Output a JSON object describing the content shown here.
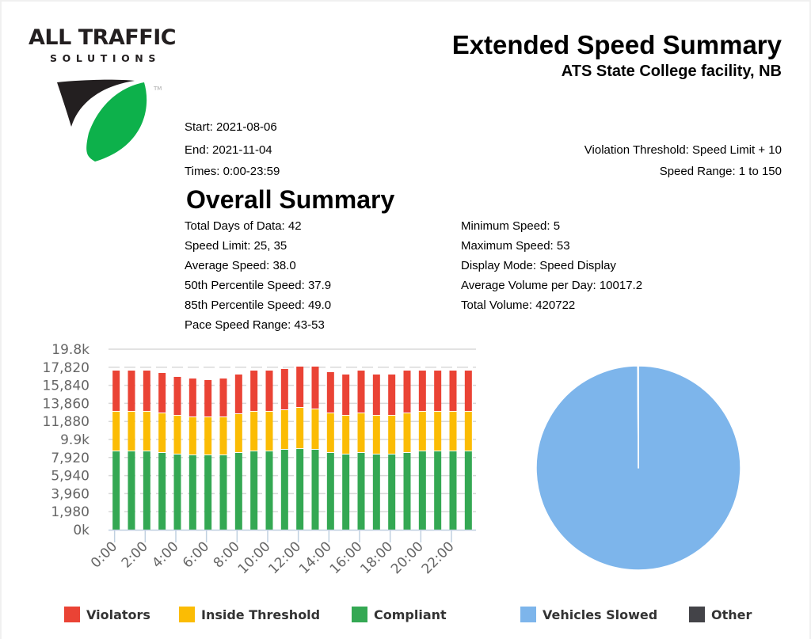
{
  "brand": {
    "name": "ALL TRAFFIC",
    "sub": "SOLUTIONS",
    "tm": "TM",
    "colors": {
      "dark": "#231f20",
      "green": "#0db14b"
    }
  },
  "header": {
    "title": "Extended Speed Summary",
    "subtitle": "ATS State College facility, NB"
  },
  "meta": {
    "start": "Start: 2021-08-06",
    "end": "End: 2021-11-04",
    "times": "Times: 0:00-23:59",
    "violation_threshold": "Violation Threshold: Speed Limit + 10",
    "speed_range": "Speed Range: 1 to 150"
  },
  "summary": {
    "heading": "Overall Summary",
    "left": [
      "Total Days of Data: 42",
      "Speed Limit: 25, 35",
      "Average Speed: 38.0",
      "50th Percentile Speed: 37.9",
      "85th Percentile Speed: 49.0",
      "Pace Speed Range: 43-53"
    ],
    "right": [
      "Minimum Speed: 5",
      "Maximum Speed: 53",
      "Display Mode: Speed Display",
      "Average Volume per Day: 10017.2",
      "Total Volume: 420722"
    ]
  },
  "chart_data": [
    {
      "type": "bar",
      "stacked": true,
      "title": "",
      "xlabel": "",
      "ylabel": "",
      "categories": [
        "0:00",
        "1:00",
        "2:00",
        "3:00",
        "4:00",
        "5:00",
        "6:00",
        "7:00",
        "8:00",
        "9:00",
        "10:00",
        "11:00",
        "12:00",
        "13:00",
        "14:00",
        "15:00",
        "16:00",
        "17:00",
        "18:00",
        "19:00",
        "20:00",
        "21:00",
        "22:00",
        "23:00"
      ],
      "x_tick_labels": [
        "0:00",
        "2:00",
        "4:00",
        "6:00",
        "8:00",
        "10:00",
        "12:00",
        "14:00",
        "16:00",
        "18:00",
        "20:00",
        "22:00"
      ],
      "y_tick_labels": [
        "0k",
        "1,980",
        "3,960",
        "5,940",
        "7,920",
        "9.9k",
        "11,880",
        "13,860",
        "15,840",
        "17,820",
        "19.8k"
      ],
      "ylim": [
        0,
        19800
      ],
      "grid": true,
      "series": [
        {
          "name": "Compliant",
          "color": "#34a853",
          "values": [
            8680,
            8680,
            8680,
            8510,
            8340,
            8250,
            8250,
            8250,
            8510,
            8680,
            8680,
            8860,
            8940,
            8860,
            8510,
            8340,
            8510,
            8340,
            8340,
            8510,
            8680,
            8680,
            8680,
            8680
          ]
        },
        {
          "name": "Inside Threshold",
          "color": "#fbbc04",
          "values": [
            4350,
            4350,
            4350,
            4340,
            4250,
            4170,
            4170,
            4170,
            4260,
            4350,
            4350,
            4340,
            4520,
            4430,
            4340,
            4250,
            4340,
            4250,
            4250,
            4340,
            4350,
            4350,
            4350,
            4350
          ]
        },
        {
          "name": "Violators",
          "color": "#ea4335",
          "values": [
            4510,
            4510,
            4510,
            4430,
            4260,
            4250,
            4080,
            4250,
            4340,
            4510,
            4510,
            4520,
            4520,
            4690,
            4520,
            4520,
            4690,
            4520,
            4520,
            4690,
            4510,
            4510,
            4510,
            4510
          ]
        }
      ],
      "legend": "bottom"
    },
    {
      "type": "pie",
      "title": "",
      "slices": [
        {
          "name": "Vehicles Slowed",
          "value": 99.9,
          "color": "#7db5eb"
        },
        {
          "name": "Other",
          "value": 0.1,
          "color": "#434348"
        }
      ],
      "legend": "bottom"
    }
  ]
}
